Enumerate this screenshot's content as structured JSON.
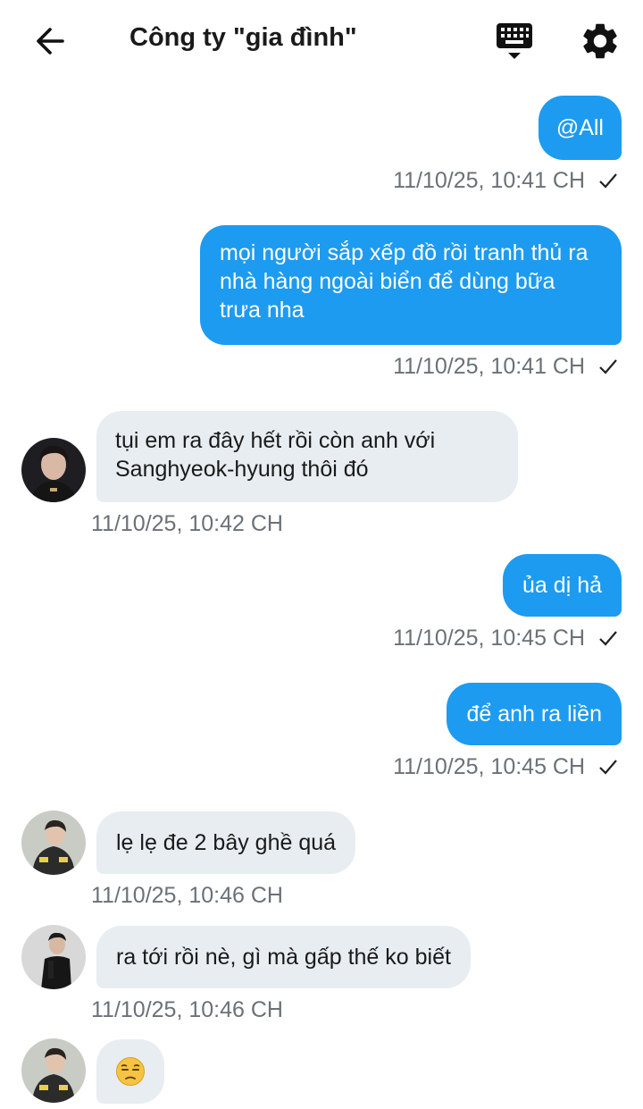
{
  "header": {
    "title": "Công ty \"gia đình\"",
    "back_icon": "arrow-left-icon",
    "keyboard_icon": "keyboard-icon",
    "settings_icon": "gear-icon"
  },
  "messages": [
    {
      "direction": "out",
      "text": "@All",
      "time": "11/10/25, 10:41 CH",
      "status": "sent-check"
    },
    {
      "direction": "out",
      "text": "mọi người sắp xếp đồ rồi tranh thủ ra nhà hàng ngoài biển để dùng bữa trưa nha",
      "time": "11/10/25, 10:41 CH",
      "status": "sent-check"
    },
    {
      "direction": "in",
      "text": "tụi em ra đây hết rồi còn anh với Sanghyeok-hyung thôi đó",
      "time": "11/10/25, 10:42 CH"
    },
    {
      "direction": "out",
      "text": "ủa dị hả",
      "time": "11/10/25, 10:45 CH",
      "status": "sent-check"
    },
    {
      "direction": "out",
      "text": "để anh ra liền",
      "time": "11/10/25, 10:45 CH",
      "status": "sent-check"
    },
    {
      "direction": "in",
      "text": "lẹ lẹ đe 2 bây ghề quá",
      "time": "11/10/25, 10:46 CH"
    },
    {
      "direction": "in",
      "text": "ra tới rồi nè, gì mà gấp thế ko biết",
      "time": "11/10/25, 10:46 CH"
    },
    {
      "direction": "in",
      "text": "😒",
      "time": ""
    }
  ],
  "colors": {
    "outgoing_bubble": "#1d9bf0",
    "incoming_bubble": "#e8edf1",
    "timestamp": "#6b7177"
  }
}
